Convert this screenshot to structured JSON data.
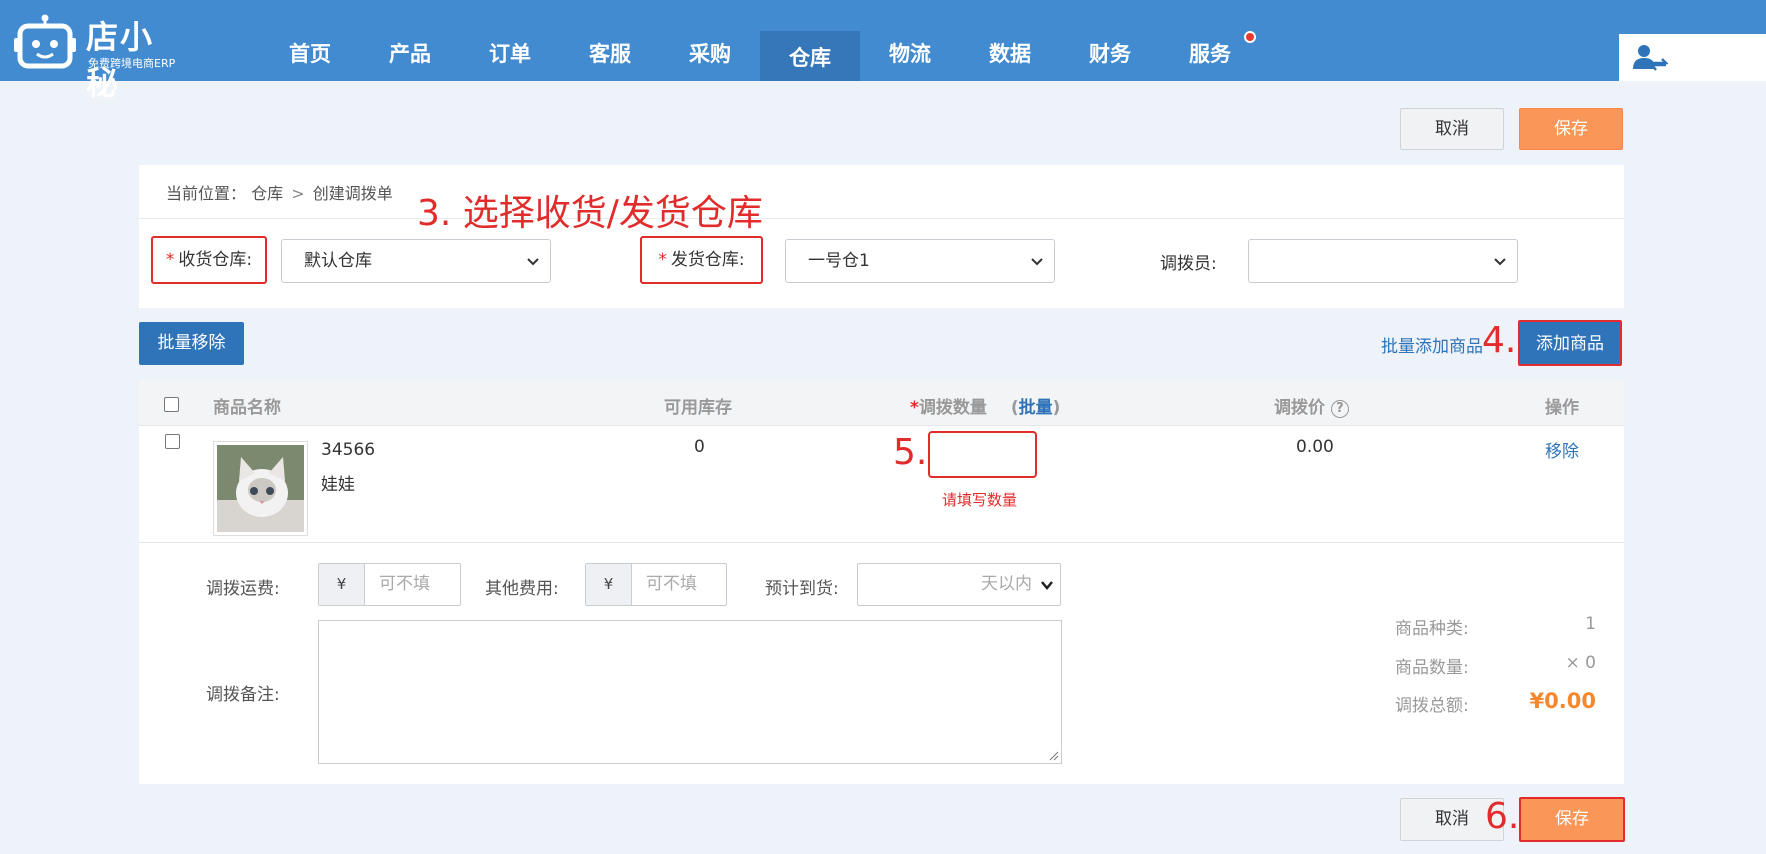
{
  "header": {
    "logo_text": "店小秘",
    "logo_sub": "免费跨境电商ERP",
    "nav": [
      {
        "label": "首页"
      },
      {
        "label": "产品"
      },
      {
        "label": "订单"
      },
      {
        "label": "客服"
      },
      {
        "label": "采购"
      },
      {
        "label": "仓库",
        "active": true
      },
      {
        "label": "物流"
      },
      {
        "label": "数据"
      },
      {
        "label": "财务"
      },
      {
        "label": "服务",
        "badge_dot": true
      }
    ],
    "user_icon": "user-icon"
  },
  "top_actions": {
    "cancel": "取消",
    "save": "保存"
  },
  "breadcrumb": {
    "prefix": "当前位置：",
    "level1": "仓库",
    "separator": ">",
    "level2": "创建调拨单"
  },
  "annotations": {
    "step3": "3. 选择收货/发货仓库",
    "step4": "4.",
    "step5": "5.",
    "step6": "6."
  },
  "warehouse_form": {
    "required_mark": "*",
    "receive_label": "收货仓库:",
    "receive_value": "默认仓库",
    "ship_label": "发货仓库:",
    "ship_value": "一号仓1",
    "clerk_label": "调拨员:",
    "clerk_value": ""
  },
  "toolbar": {
    "batch_remove": "批量移除",
    "batch_add": "批量添加商品",
    "add_product": "添加商品"
  },
  "table": {
    "headers": {
      "name": "商品名称",
      "stock": "可用库存",
      "qty_required": "*",
      "qty": "调拨数量",
      "qty_batch_open": "(",
      "qty_batch": "批量",
      "qty_batch_close": ")",
      "price": "调拨价",
      "price_help": "?",
      "action": "操作"
    },
    "rows": [
      {
        "sku": "34566",
        "name": "娃娃",
        "stock": "0",
        "qty": "",
        "qty_error": "请填写数量",
        "price": "0.00",
        "action": "移除"
      }
    ]
  },
  "extra_form": {
    "freight_label": "调拨运费:",
    "currency": "¥",
    "freight_placeholder": "可不填",
    "other_label": "其他费用:",
    "other_placeholder": "可不填",
    "eta_label": "预计到货:",
    "eta_value": "天以内",
    "remark_label": "调拨备注:"
  },
  "summary": {
    "kinds_label": "商品种类:",
    "kinds_value": "1",
    "qty_label": "商品数量:",
    "qty_value": "× 0",
    "total_label": "调拨总额:",
    "total_value": "¥0.00"
  },
  "bottom_actions": {
    "cancel": "取消",
    "save": "保存"
  },
  "colors": {
    "nav_bg": "#428bd0",
    "accent_orange": "#fb9659",
    "primary_blue": "#2f74b9",
    "annotation_red": "#e22c2c"
  }
}
